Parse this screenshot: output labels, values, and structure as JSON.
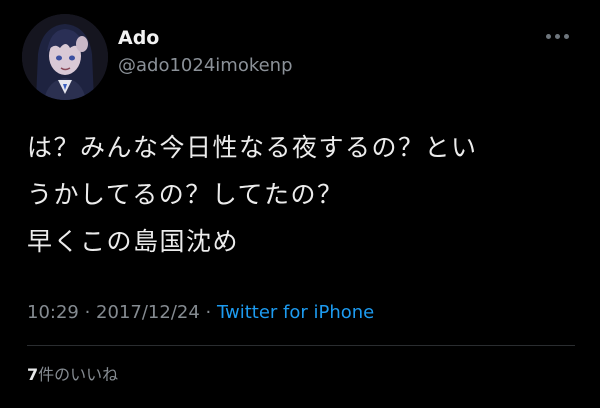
{
  "tweet": {
    "author": {
      "display_name": "Ado",
      "handle": "@ado1024imokenp",
      "avatar_icon": "user-avatar-icon"
    },
    "more_icon": "more-horizontal-icon",
    "text_lines": [
      "は？みんな今日性なる夜するの？とい",
      "うかしてるの？してたの？",
      "早くこの島国沈め"
    ],
    "meta": {
      "time": "10:29",
      "separator": " · ",
      "date": "2017/12/24",
      "source": "Twitter for iPhone"
    },
    "likes": {
      "count": "7",
      "label": "件のいいね"
    }
  },
  "colors": {
    "background": "#000000",
    "text": "#e7e9ea",
    "secondary": "#858b91",
    "link": "#1d9bf0"
  }
}
